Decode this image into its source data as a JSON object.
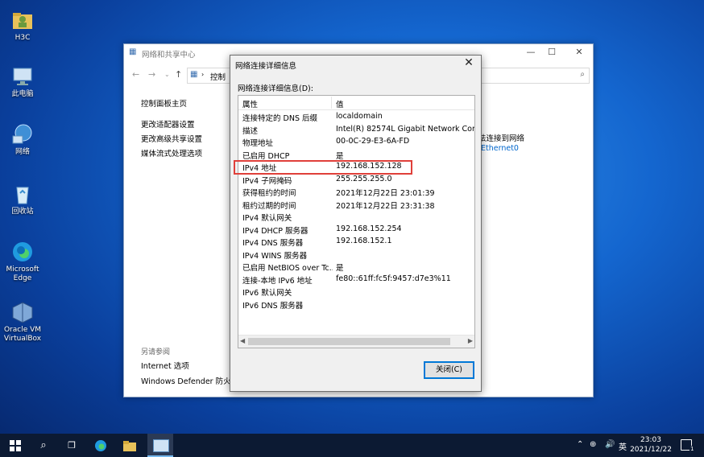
{
  "desktop": {
    "icons": [
      {
        "label": "H3C"
      },
      {
        "label": "此电脑"
      },
      {
        "label": "网络"
      },
      {
        "label": "回收站"
      },
      {
        "label": "Microsoft Edge"
      },
      {
        "label": "Oracle VM VirtualBox"
      }
    ]
  },
  "bg_window": {
    "title": "网络和共享中心",
    "address_crumb": "控制",
    "left_links": [
      "控制面板主页",
      "更改适配器设置",
      "更改高级共享设置",
      "媒体流式处理选项"
    ],
    "see_also_label": "另请参阅",
    "see_also_links": [
      "Internet 选项",
      "Windows Defender 防火墙"
    ],
    "right_text": "法连接到网络",
    "right_link": "Ethernet0"
  },
  "dialog": {
    "title": "网络连接详细信息",
    "label": "网络连接详细信息(D):",
    "columns": {
      "property": "属性",
      "value": "值"
    },
    "rows": [
      {
        "property": "连接特定的 DNS 后缀",
        "value": "localdomain"
      },
      {
        "property": "描述",
        "value": "Intel(R) 82574L Gigabit Network Conne"
      },
      {
        "property": "物理地址",
        "value": "00-0C-29-E3-6A-FD"
      },
      {
        "property": "已启用 DHCP",
        "value": "是"
      },
      {
        "property": "IPv4 地址",
        "value": "192.168.152.128"
      },
      {
        "property": "IPv4 子网掩码",
        "value": "255.255.255.0"
      },
      {
        "property": "获得租约的时间",
        "value": "2021年12月22日 23:01:39"
      },
      {
        "property": "租约过期的时间",
        "value": "2021年12月22日 23:31:38"
      },
      {
        "property": "IPv4 默认网关",
        "value": ""
      },
      {
        "property": "IPv4 DHCP 服务器",
        "value": "192.168.152.254"
      },
      {
        "property": "IPv4 DNS 服务器",
        "value": "192.168.152.1"
      },
      {
        "property": "IPv4 WINS 服务器",
        "value": ""
      },
      {
        "property": "已启用 NetBIOS over Tc...",
        "value": "是"
      },
      {
        "property": "连接-本地 IPv6 地址",
        "value": "fe80::61ff:fc5f:9457:d7e3%11"
      },
      {
        "property": "IPv6 默认网关",
        "value": ""
      },
      {
        "property": "IPv6 DNS 服务器",
        "value": ""
      }
    ],
    "close_label": "关闭(C)"
  },
  "taskbar": {
    "tray_ime": "英",
    "time": "23:03",
    "date": "2021/12/22",
    "notification_count": "1"
  },
  "colors": {
    "highlight": "#e0403a",
    "link": "#0066cc",
    "button_border": "#0078d7"
  }
}
